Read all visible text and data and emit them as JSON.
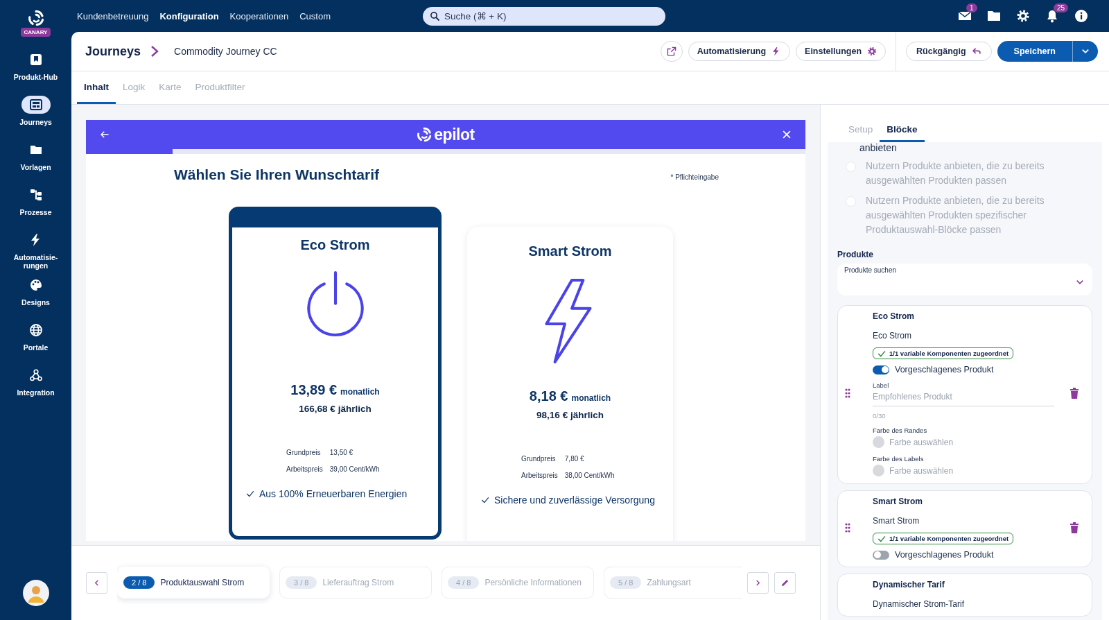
{
  "brand": {
    "badge": "CANARY"
  },
  "sidebar": {
    "items": [
      {
        "label": "Produkt-Hub",
        "selected": false
      },
      {
        "label": "Journeys",
        "selected": true
      },
      {
        "label": "Vorlagen",
        "selected": false
      },
      {
        "label": "Prozesse",
        "selected": false
      },
      {
        "label": "Automatisie-\nrungen",
        "selected": false
      },
      {
        "label": "Designs",
        "selected": false
      },
      {
        "label": "Portale",
        "selected": false
      },
      {
        "label": "Integration",
        "selected": false
      }
    ]
  },
  "top_nav": [
    {
      "label": "Kundenbetreuung",
      "selected": false
    },
    {
      "label": "Konfiguration",
      "selected": true
    },
    {
      "label": "Kooperationen",
      "selected": false
    },
    {
      "label": "Custom",
      "selected": false
    }
  ],
  "search": {
    "placeholder": "Suche (⌘ + K)"
  },
  "top_bar": {
    "mail_badge": "1",
    "notification_badge": "25"
  },
  "breadcrumb": [
    "Journeys",
    "Commodity Journey CC"
  ],
  "header_buttons": [
    "Automatisierung",
    "Einstellungen"
  ],
  "undo_button": "Rückgängig",
  "save_button": "Speichern",
  "tabs": [
    {
      "label": "Inhalt",
      "selected": true
    },
    {
      "label": "Logik",
      "selected": false
    },
    {
      "label": "Karte",
      "selected": false
    },
    {
      "label": "Produktfilter",
      "selected": false
    }
  ],
  "preview": {
    "brand": "epilot",
    "progress": {
      "level": 0.12
    },
    "title": "Wählen Sie Ihren Wunschtarif",
    "required_note": "* Pflichteingabe",
    "products": [
      {
        "name": "Eco Strom",
        "selected": true,
        "kind": "power",
        "price": "13,89 €",
        "price_unit": "monatlich",
        "yearly": "166,68 € jährlich",
        "details": [
          {
            "label": "Grundpreis",
            "value": "13,50 €"
          },
          {
            "label": "Arbeitspreis",
            "value": "39,00 Cent/kWh"
          }
        ],
        "feature": "Aus 100% Erneuerbaren Energien"
      },
      {
        "name": "Smart Strom",
        "selected": false,
        "kind": "bolt",
        "price": "8,18 €",
        "price_unit": "monatlich",
        "yearly": "98,16 € jährlich",
        "details": [
          {
            "label": "Grundpreis",
            "value": "7,80 €"
          },
          {
            "label": "Arbeitspreis",
            "value": "38,00 Cent/kWh"
          }
        ],
        "feature": "Sichere und zuverlässige Versorgung"
      }
    ]
  },
  "settings_panel": {
    "tabs": [
      {
        "label": "Setup",
        "selected": false
      },
      {
        "label": "Blöcke",
        "selected": true
      }
    ],
    "cut_text": "anbieten",
    "options": [
      {
        "text": "Nutzern Produkte anbieten, die zu bereits ausgewählten Produkten passen",
        "selected": false,
        "disabled": true
      },
      {
        "text": "Nutzern Produkte anbieten, die zu bereits ausgewählten Produkten spezifischer Produktauswahl-Blöcke passen",
        "selected": false,
        "disabled": true
      }
    ],
    "products_label": "Produkte",
    "products_select": {
      "placeholder": "Produkte suchen"
    },
    "product_cards": [
      {
        "title": "Eco Strom",
        "name": "Eco Strom",
        "badge": "1/1 variable Komponenten zugeordnet",
        "suggested": true,
        "suggested_label": "Vorgeschlagenes Produkt",
        "label_field": {
          "label": "Label",
          "placeholder": "Empfohlenes Produkt",
          "counter": "0/30"
        },
        "colors": [
          {
            "label": "Farbe des Randes",
            "placeholder": "Farbe auswählen"
          },
          {
            "label": "Farbe des Labels",
            "placeholder": "Farbe auswählen"
          }
        ]
      },
      {
        "title": "Smart Strom",
        "name": "Smart Strom",
        "badge": "1/1 variable Komponenten zugeordnet",
        "suggested": false,
        "suggested_label": "Vorgeschlagenes Produkt"
      },
      {
        "title": "Dynamischer Tarif",
        "name": "Dynamischer Strom-Tarif"
      }
    ]
  },
  "stepper": {
    "steps": [
      {
        "number": "2 / 8",
        "label": "Produktauswahl Strom",
        "selected": true
      },
      {
        "number": "3 / 8",
        "label": "Lieferauftrag Strom",
        "selected": false
      },
      {
        "number": "4 / 8",
        "label": "Persönliche Informationen",
        "selected": false
      },
      {
        "number": "5 / 8",
        "label": "Zahlungsart",
        "selected": false
      }
    ]
  }
}
